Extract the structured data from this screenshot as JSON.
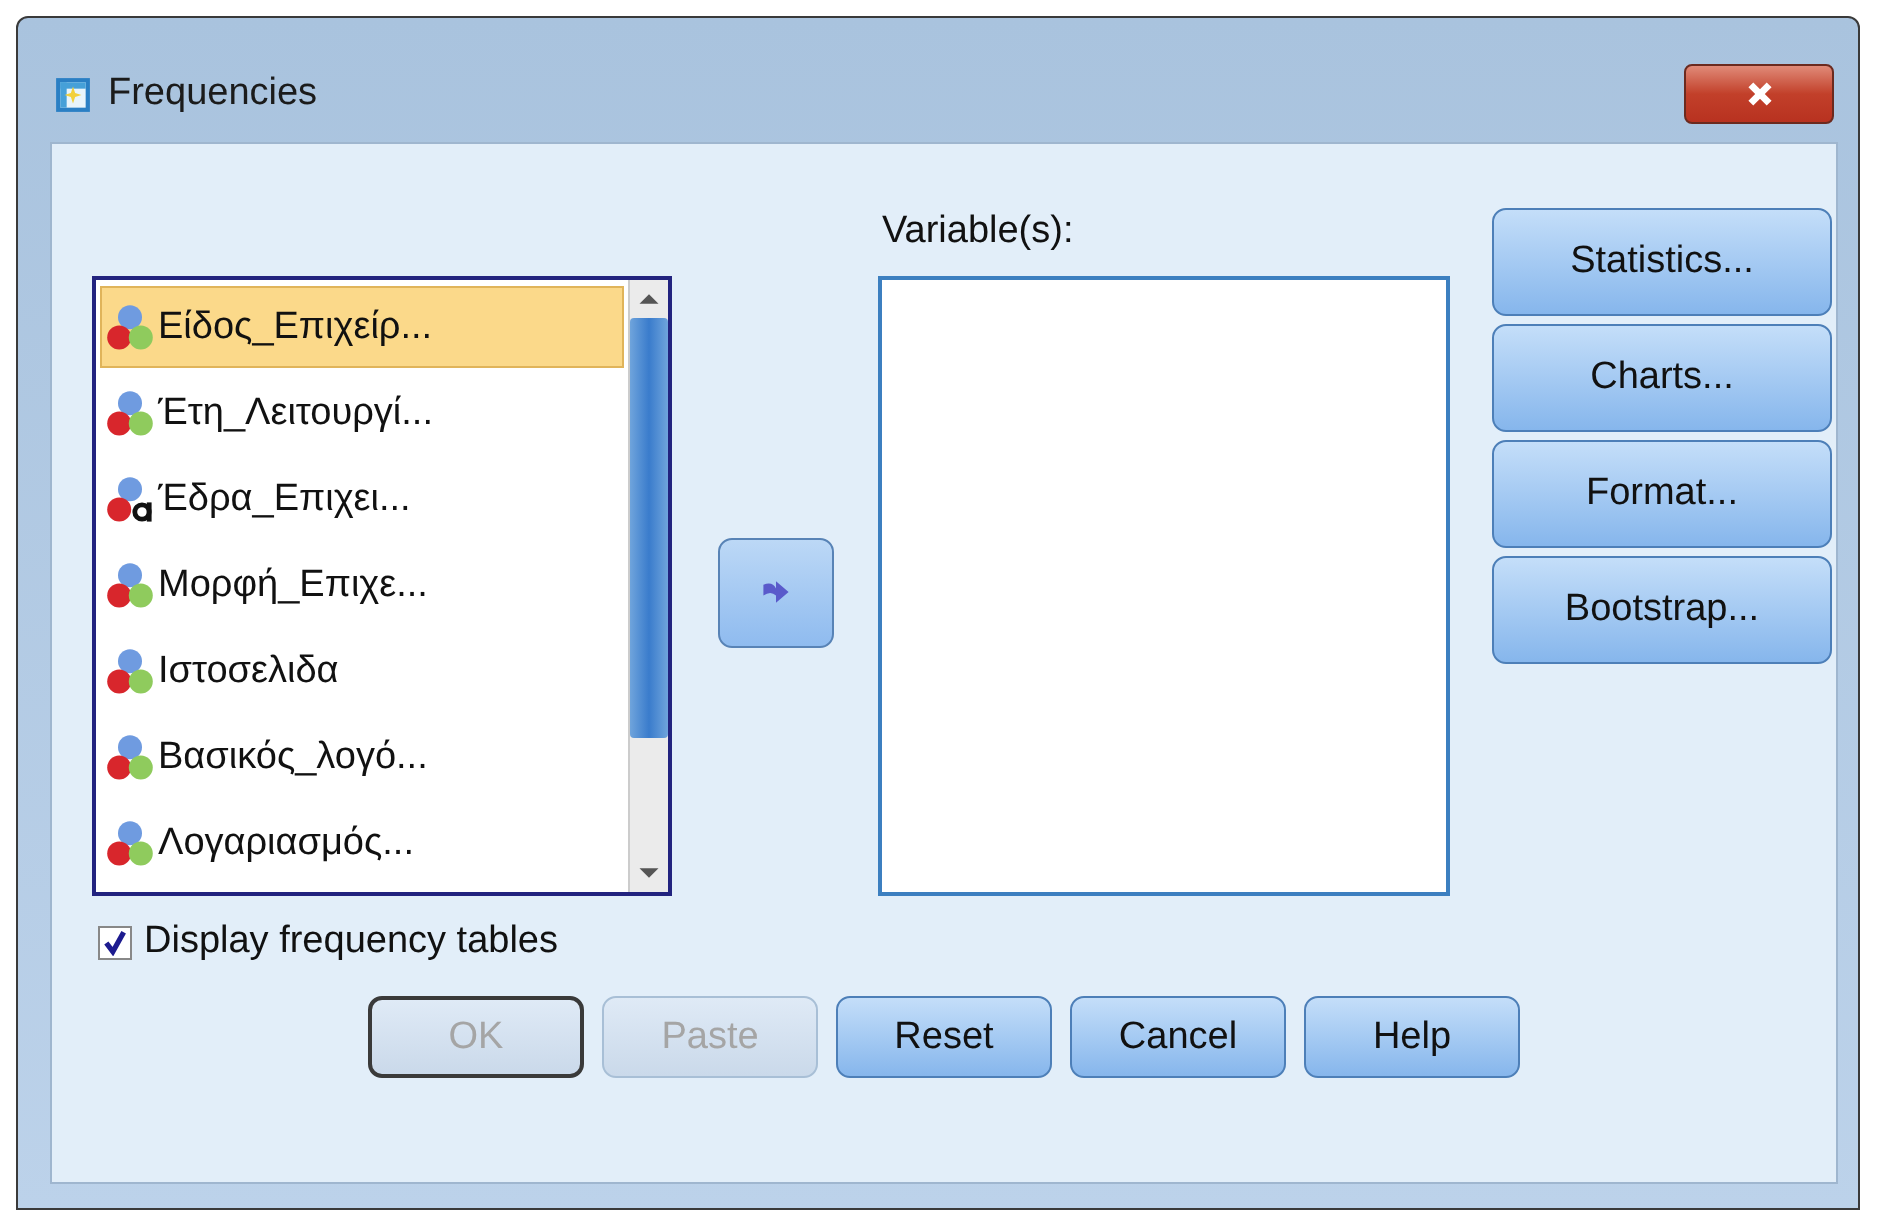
{
  "window": {
    "title": "Frequencies"
  },
  "source_list": {
    "items": [
      {
        "label": "Είδος_Επιχείρ...",
        "kind": "nominal",
        "selected": true
      },
      {
        "label": "Έτη_Λειτουργί...",
        "kind": "nominal",
        "selected": false
      },
      {
        "label": "Έδρα_Επιχει...",
        "kind": "string",
        "selected": false
      },
      {
        "label": "Μορφή_Επιχε...",
        "kind": "nominal",
        "selected": false
      },
      {
        "label": "Ιστοσελιδα",
        "kind": "nominal",
        "selected": false
      },
      {
        "label": "Βασικός_λογό...",
        "kind": "nominal",
        "selected": false
      },
      {
        "label": "Λογαριασμός...",
        "kind": "nominal",
        "selected": false
      }
    ]
  },
  "target_list": {
    "label": "Variable(s):"
  },
  "side_buttons": [
    "Statistics...",
    "Charts...",
    "Format...",
    "Bootstrap..."
  ],
  "display_frequency_tables": {
    "label": "Display frequency tables",
    "checked": true
  },
  "buttons": [
    {
      "label": "OK",
      "disabled": true,
      "default": true
    },
    {
      "label": "Paste",
      "disabled": true,
      "default": false
    },
    {
      "label": "Reset",
      "disabled": false,
      "default": false
    },
    {
      "label": "Cancel",
      "disabled": false,
      "default": false
    },
    {
      "label": "Help",
      "disabled": false,
      "default": false
    }
  ]
}
